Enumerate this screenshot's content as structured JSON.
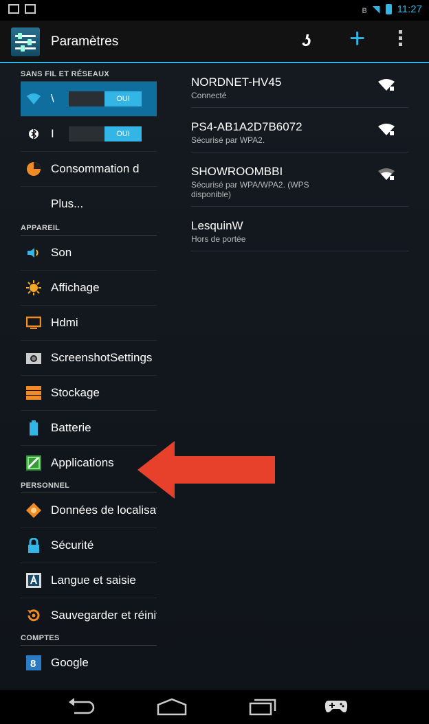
{
  "status": {
    "time": "11:27"
  },
  "actionbar": {
    "title": "Paramètres"
  },
  "sections": {
    "wireless": "SANS FIL ET RÉSEAUX",
    "device": "APPAREIL",
    "personal": "PERSONNEL",
    "accounts": "COMPTES"
  },
  "wireless_items": {
    "wifi_label": "\\",
    "wifi_toggle": "OUI",
    "bt_label": "I",
    "bt_toggle": "OUI",
    "data_usage": "Consommation d",
    "more": "Plus..."
  },
  "device_items": [
    "Son",
    "Affichage",
    "Hdmi",
    "ScreenshotSettings",
    "Stockage",
    "Batterie",
    "Applications"
  ],
  "personal_items": [
    "Données de localisation",
    "Sécurité",
    "Langue et saisie",
    "Sauvegarder et réinitialiser"
  ],
  "account_items": [
    "Google"
  ],
  "networks": [
    {
      "name": "NORDNET-HV45",
      "status": "Connecté"
    },
    {
      "name": "PS4-AB1A2D7B6072",
      "status": "Sécurisé par WPA2."
    },
    {
      "name": "SHOWROOMBBI",
      "status": "Sécurisé par WPA/WPA2. (WPS disponible)"
    },
    {
      "name": "LesquinW",
      "status": "Hors de portée"
    }
  ],
  "colors": {
    "accent": "#33b5e5",
    "arrow": "#e8412b"
  }
}
